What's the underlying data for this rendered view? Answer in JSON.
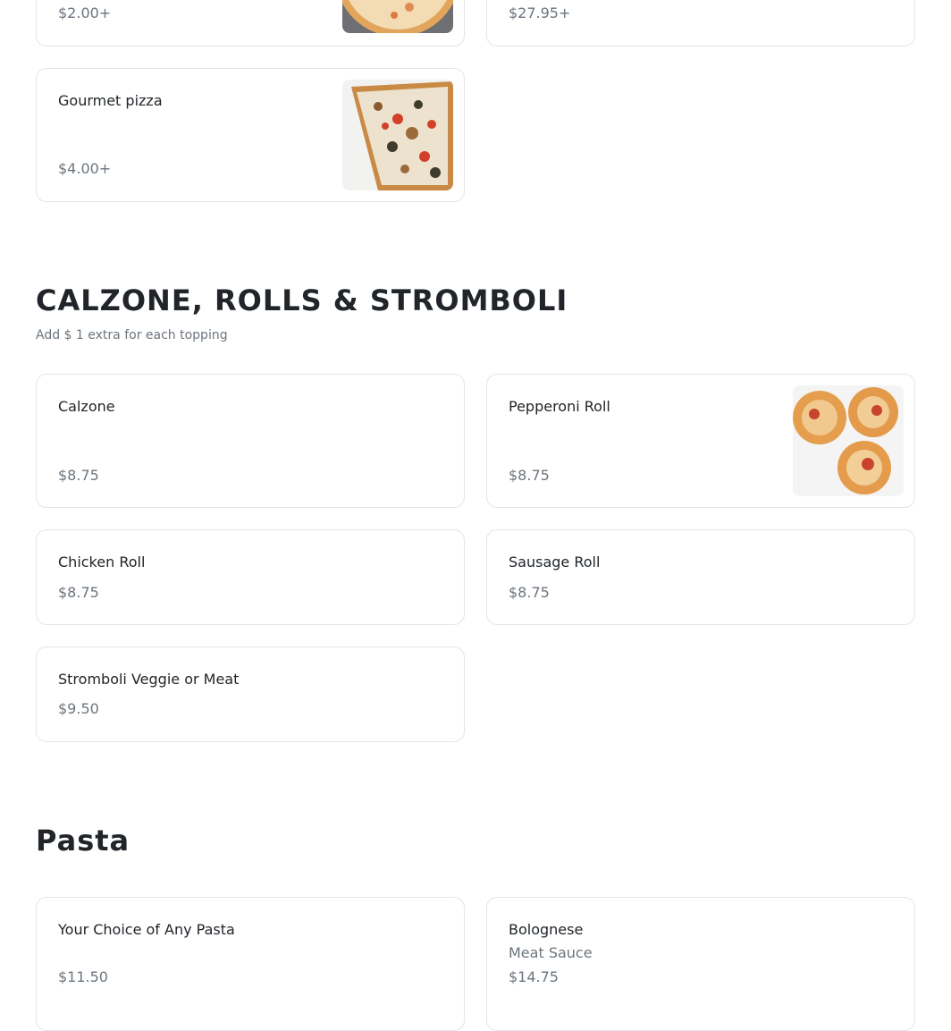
{
  "pizza_section": {
    "items": [
      {
        "name": "",
        "price": "$2.00+"
      },
      {
        "name": "",
        "price": "$27.95+"
      },
      {
        "name": "Gourmet pizza",
        "price": "$4.00+"
      }
    ]
  },
  "calzone_section": {
    "title": "CALZONE, ROLLS & STROMBOLI",
    "subtitle": "Add $ 1 extra for each topping",
    "items": [
      {
        "name": "Calzone",
        "price": "$8.75"
      },
      {
        "name": "Pepperoni Roll",
        "price": "$8.75"
      },
      {
        "name": "Chicken Roll",
        "price": "$8.75"
      },
      {
        "name": "Sausage Roll",
        "price": "$8.75"
      },
      {
        "name": "Stromboli Veggie or Meat",
        "price": "$9.50"
      }
    ]
  },
  "pasta_section": {
    "title": "Pasta",
    "items": [
      {
        "name": "Your Choice of Any Pasta",
        "price": "$11.50"
      },
      {
        "name": "Bolognese",
        "description": "Meat Sauce",
        "price": "$14.75"
      }
    ]
  },
  "colors": {
    "text_primary": "#212529",
    "text_secondary": "#6c757d",
    "card_border": "#e3e5e8"
  }
}
